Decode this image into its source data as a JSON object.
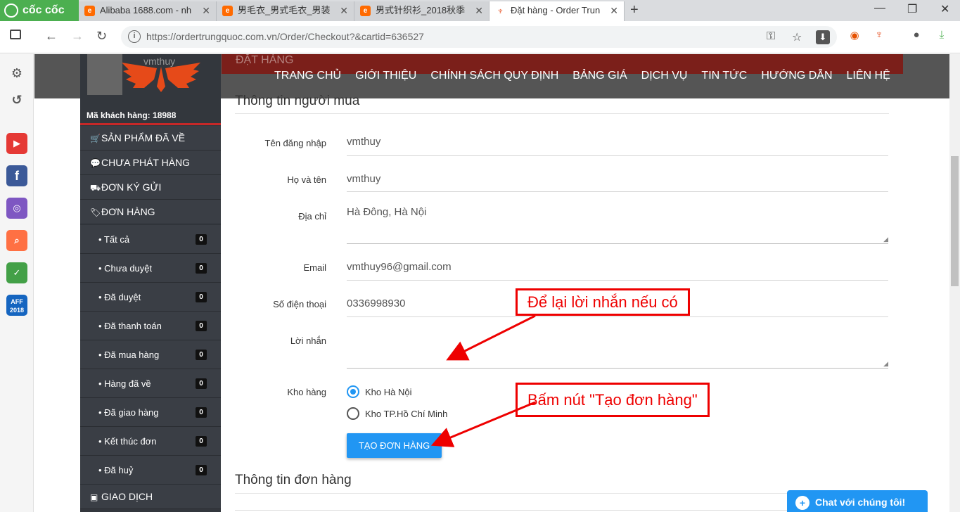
{
  "browser": {
    "brand": "cốc cốc",
    "tabs": [
      {
        "title": "Alibaba 1688.com - nh",
        "favicon": "alibaba-icon"
      },
      {
        "title": "男毛衣_男式毛衣_男装",
        "favicon": "alibaba-icon"
      },
      {
        "title": "男式针织衫_2018秋季",
        "favicon": "alibaba-icon"
      },
      {
        "title": "Đặt hàng - Order Trun",
        "favicon": "wings-icon",
        "active": true
      }
    ],
    "url": "https://ordertrungquoc.com.vn/Order/Checkout?&cartid=636527"
  },
  "site": {
    "banner_title": "ĐẶT HÀNG",
    "menu": [
      "TRANG CHỦ",
      "GIỚI THIỆU",
      "CHÍNH SÁCH QUY ĐỊNH",
      "BẢNG GIÁ",
      "DỊCH VỤ",
      "TIN TỨC",
      "HƯỚNG DẪN",
      "LIÊN HỆ"
    ],
    "colors": {
      "accent": "#2196f3",
      "danger": "#e00000",
      "sidebar": "#33373d"
    }
  },
  "sidebar": {
    "username": "vmthuy",
    "customer_id_label": "Mã khách hàng:",
    "customer_id": "18988",
    "items": [
      {
        "label": "SẢN PHẨM ĐÃ VỀ",
        "icon": "cart-icon"
      },
      {
        "label": "CHƯA PHÁT HÀNG",
        "icon": "comment-icon"
      },
      {
        "label": "ĐƠN KÝ GỬI",
        "icon": "truck-icon"
      },
      {
        "label": "ĐƠN HÀNG",
        "icon": "tags-icon"
      }
    ],
    "subitems": [
      {
        "label": "• Tất cả",
        "count": "0"
      },
      {
        "label": "• Chưa duyệt",
        "count": "0"
      },
      {
        "label": "• Đã duyệt",
        "count": "0"
      },
      {
        "label": "• Đã thanh toán",
        "count": "0"
      },
      {
        "label": "• Đã mua hàng",
        "count": "0"
      },
      {
        "label": "• Hàng đã về",
        "count": "0"
      },
      {
        "label": "• Đã giao hàng",
        "count": "0"
      },
      {
        "label": "• Kết thúc đơn",
        "count": "0"
      },
      {
        "label": "• Đã huỷ",
        "count": "0"
      }
    ],
    "bottom_item": {
      "label": "GIAO DỊCH",
      "icon": "money-icon"
    }
  },
  "form": {
    "section_buyer": "Thông tin người mua",
    "username_label": "Tên đăng nhập",
    "username": "vmthuy",
    "fullname_label": "Họ và tên",
    "fullname": "vmthuy",
    "address_label": "Địa chỉ",
    "address": "Hà Đông, Hà Nội",
    "email_label": "Email",
    "email": "vmthuy96@gmail.com",
    "phone_label": "Số điện thoại",
    "phone": "0336998930",
    "message_label": "Lời nhắn",
    "message": "",
    "warehouse_label": "Kho hàng",
    "warehouses": [
      {
        "label": "Kho Hà Nội",
        "selected": true
      },
      {
        "label": "Kho TP.Hồ Chí Minh",
        "selected": false
      }
    ],
    "submit_label": "TẠO ĐƠN HÀNG",
    "section_order": "Thông tin đơn hàng"
  },
  "annotations": {
    "callout_message": "Để lại lời nhắn nếu có",
    "callout_button": "Bấm nút \"Tạo đơn hàng\""
  },
  "chat": {
    "label": "Chat với chúng tôi!"
  }
}
